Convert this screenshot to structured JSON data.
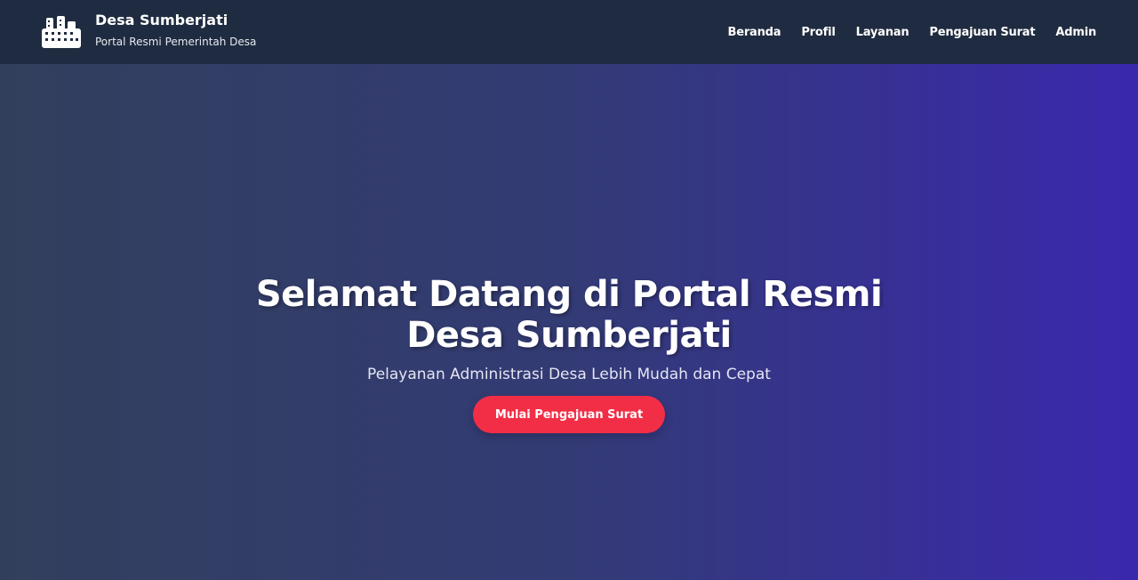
{
  "colors": {
    "navbar_bg": "#1f2b40",
    "hero_gradient_start": "#323f5c",
    "hero_gradient_end": "#3a28ad",
    "cta_button": "#f22e46",
    "text": "#ffffff"
  },
  "header": {
    "logo_icon": "building-icon",
    "title": "Desa Sumberjati",
    "subtitle": "Portal Resmi Pemerintah Desa",
    "nav": [
      {
        "label": "Beranda"
      },
      {
        "label": "Profil"
      },
      {
        "label": "Layanan"
      },
      {
        "label": "Pengajuan Surat"
      },
      {
        "label": "Admin"
      }
    ]
  },
  "hero": {
    "title_line1": "Selamat Datang di Portal Resmi",
    "title_line2": "Desa Sumberjati",
    "subtitle": "Pelayanan Administrasi Desa Lebih Mudah dan Cepat",
    "cta_label": "Mulai Pengajuan Surat"
  }
}
